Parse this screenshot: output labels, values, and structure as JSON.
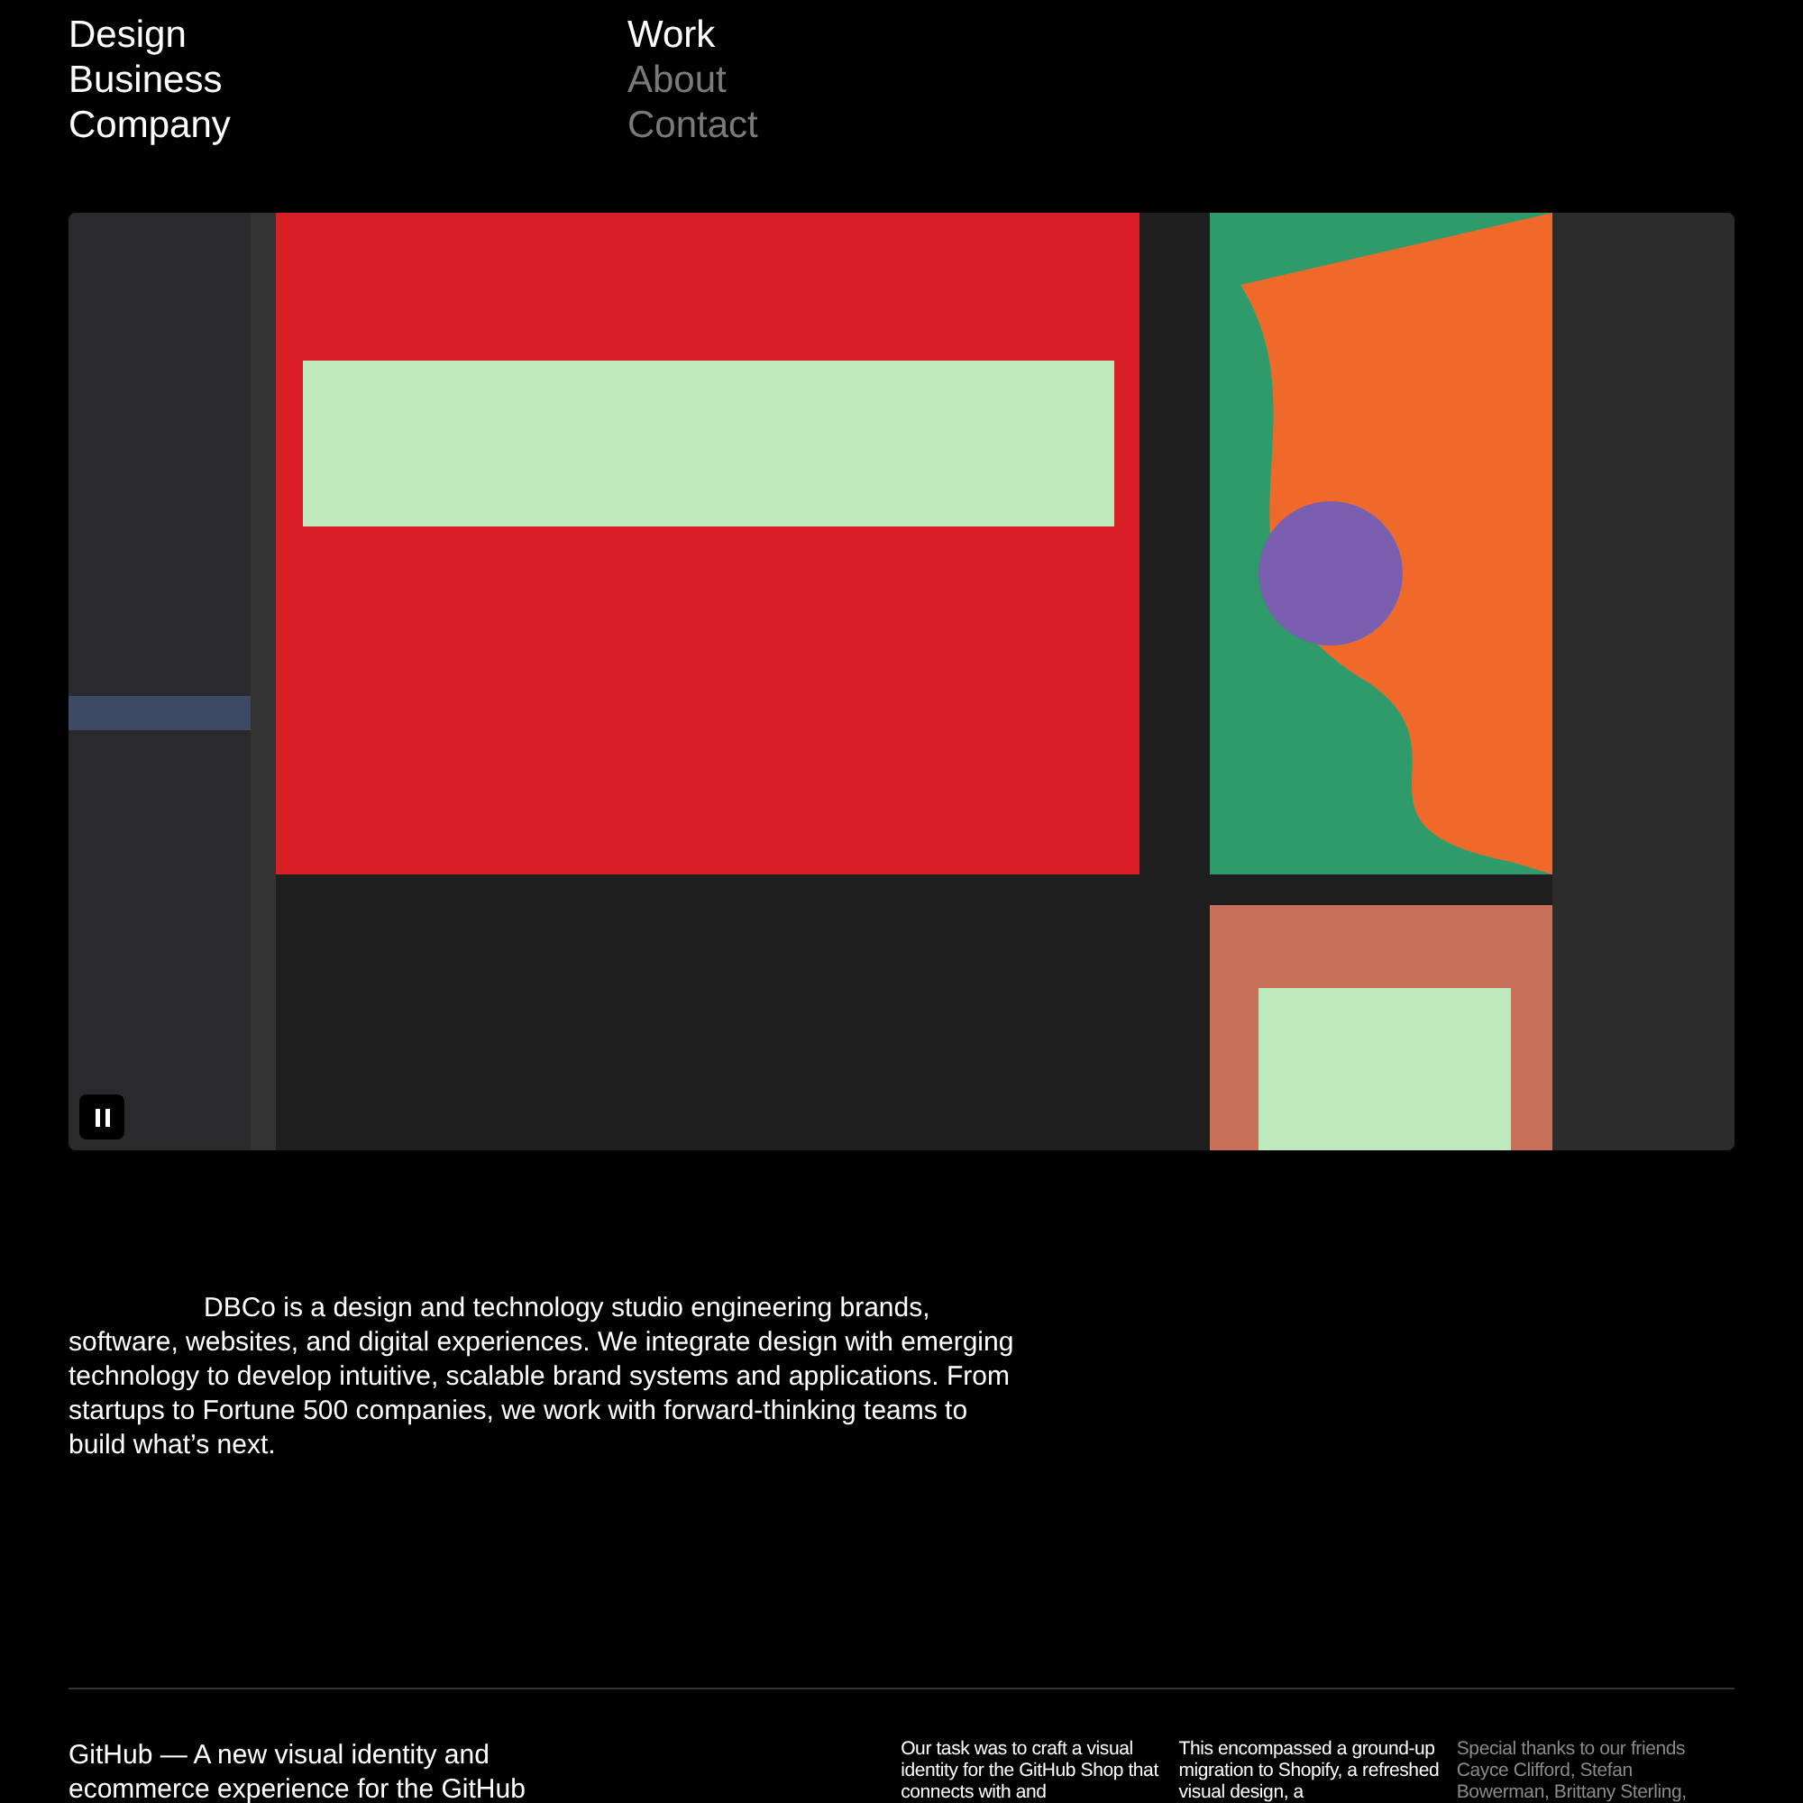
{
  "brand": {
    "lines": [
      "Design",
      "Business",
      "Company"
    ]
  },
  "nav": [
    {
      "label": "Work",
      "selected": true
    },
    {
      "label": "About",
      "selected": false
    },
    {
      "label": "Contact",
      "selected": false
    }
  ],
  "hero": {
    "kind": "picture",
    "playing": true
  },
  "intro": "DBCo is a design and technology studio engineering brands, software, websites, and digital experiences. We integrate design with emerging technology to develop intuitive, scalable brand systems and applications. From startups to Fortune 500 companies, we work with forward-thinking teams to build what’s next.",
  "project": {
    "title": "GitHub — A new visual identity and ecommerce experience for the GitHub",
    "columns": [
      {
        "text": "Our task was to craft a visual identity for the GitHub Shop that connects with and",
        "muted": false
      },
      {
        "text": "This encompassed a ground-up migration to Shopify, a refreshed visual design, a",
        "muted": false
      },
      {
        "text": "Special thanks to our friends Cayce Clifford, Stefan Bowerman, Brittany Sterling,",
        "muted": true
      }
    ]
  }
}
